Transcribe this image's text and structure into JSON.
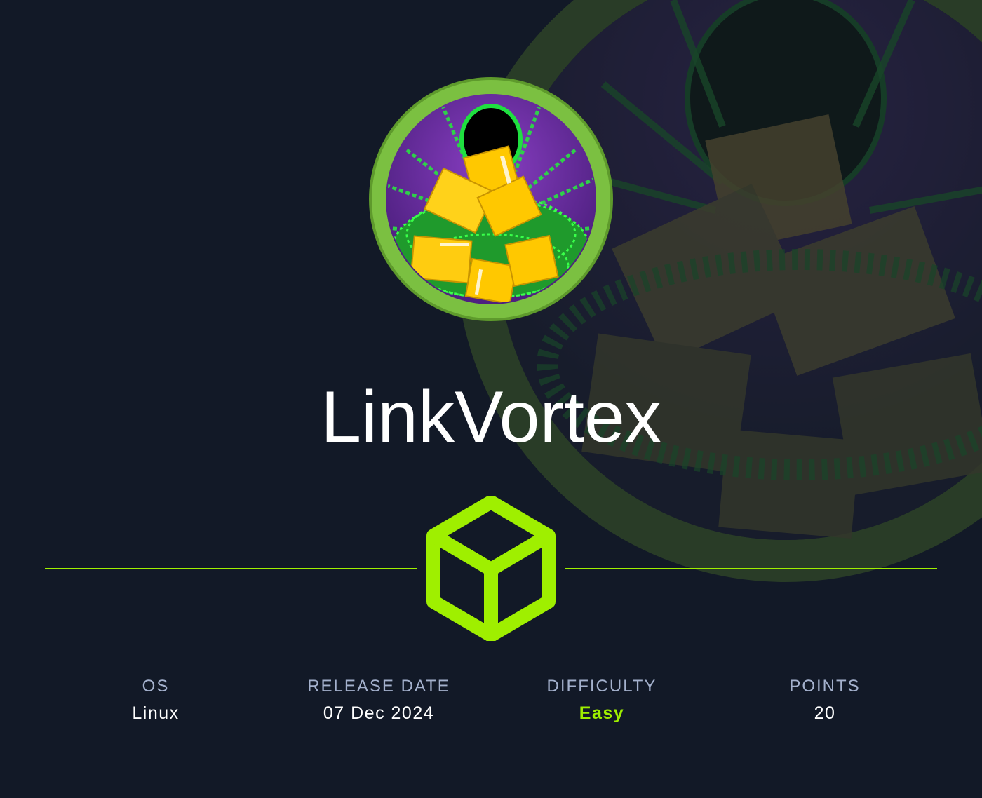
{
  "machine": {
    "name": "LinkVortex"
  },
  "stats": [
    {
      "label": "OS",
      "value": "Linux"
    },
    {
      "label": "RELEASE DATE",
      "value": "07 Dec 2024"
    },
    {
      "label": "DIFFICULTY",
      "value": "Easy"
    },
    {
      "label": "POINTS",
      "value": "20"
    }
  ],
  "icons": {
    "avatar": "machine-avatar-chained-folders",
    "divider": "htb-cube-icon"
  },
  "colors": {
    "background": "#121927",
    "accent": "#9fef00",
    "label": "#a4b1cd",
    "text": "#ffffff"
  }
}
